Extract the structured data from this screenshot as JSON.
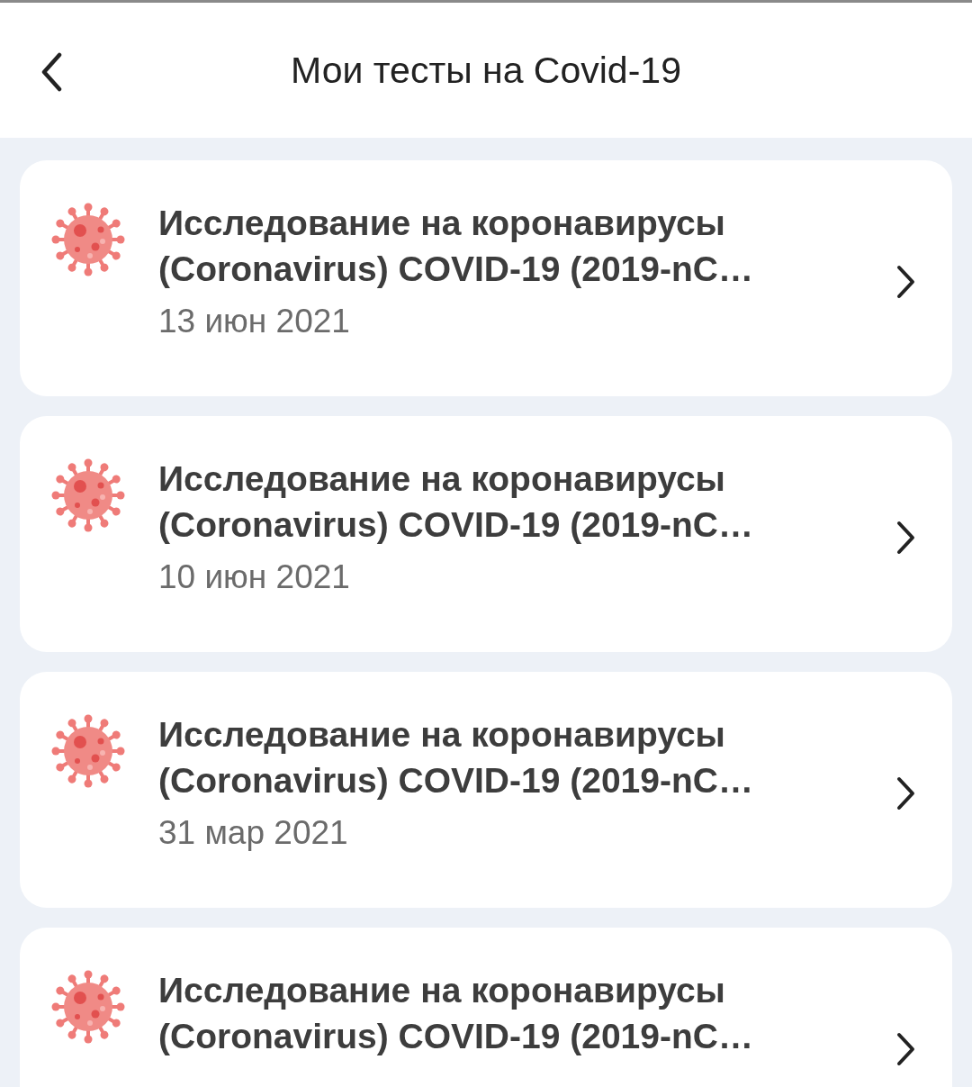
{
  "header": {
    "title": "Мои тесты на Covid-19"
  },
  "tests": [
    {
      "title": "Исследование на коронавирусы (Coronavirus) COVID-19 (2019-nC…",
      "date": "13 июн 2021"
    },
    {
      "title": "Исследование на коронавирусы (Coronavirus) COVID-19 (2019-nC…",
      "date": "10 июн 2021"
    },
    {
      "title": "Исследование на коронавирусы (Coronavirus) COVID-19 (2019-nC…",
      "date": "31 мар 2021"
    },
    {
      "title": "Исследование на коронавирусы (Coronavirus) COVID-19 (2019-nC…"
    }
  ]
}
